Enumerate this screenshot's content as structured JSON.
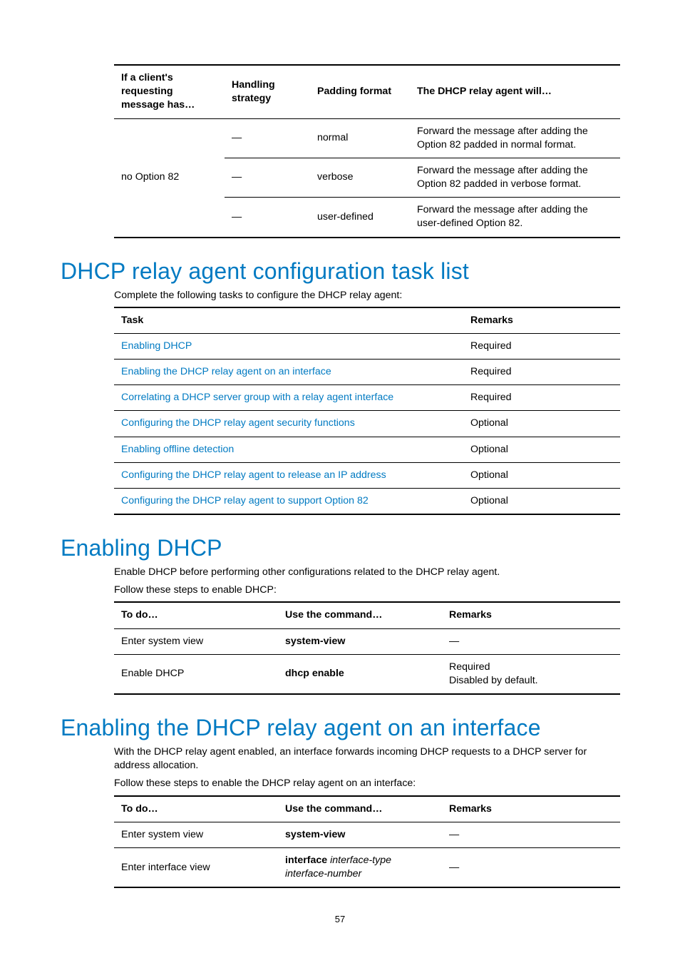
{
  "t1": {
    "h1": "If a client's requesting message has…",
    "h2": "Handling strategy",
    "h3": "Padding format",
    "h4": "The DHCP relay agent will…",
    "rspan": "no Option 82",
    "r1": {
      "strategy": "—",
      "padding": "normal",
      "action": "Forward the message after adding the Option 82 padded in normal format."
    },
    "r2": {
      "strategy": "—",
      "padding": "verbose",
      "action": "Forward the message after adding the Option 82 padded in verbose format."
    },
    "r3": {
      "strategy": "—",
      "padding": "user-defined",
      "action": "Forward the message after adding the user-defined Option 82."
    }
  },
  "sec1": {
    "title": "DHCP relay agent configuration task list",
    "intro": "Complete the following tasks to configure the DHCP relay agent:"
  },
  "t2": {
    "h1": "Task",
    "h2": "Remarks",
    "rows": [
      {
        "task": "Enabling DHCP",
        "rem": "Required"
      },
      {
        "task": "Enabling the DHCP relay agent on an interface",
        "rem": "Required"
      },
      {
        "task": "Correlating a DHCP server group with a relay agent interface",
        "rem": "Required"
      },
      {
        "task": "Configuring the DHCP relay agent security functions",
        "rem": "Optional"
      },
      {
        "task": "Enabling offline detection",
        "rem": "Optional"
      },
      {
        "task": "Configuring the DHCP relay agent to release an IP address",
        "rem": "Optional"
      },
      {
        "task": "Configuring the DHCP relay agent to support Option 82",
        "rem": "Optional"
      }
    ]
  },
  "sec2": {
    "title": "Enabling DHCP",
    "p1": "Enable DHCP before performing other configurations related to the DHCP relay agent.",
    "p2": "Follow these steps to enable DHCP:"
  },
  "t3": {
    "h1": "To do…",
    "h2": "Use the command…",
    "h3": "Remarks",
    "r1": {
      "todo": "Enter system view",
      "cmd": "system-view",
      "rem": "—"
    },
    "r2": {
      "todo": "Enable DHCP",
      "cmd": "dhcp enable",
      "rem1": "Required",
      "rem2": "Disabled by default."
    }
  },
  "sec3": {
    "title": "Enabling the DHCP relay agent on an interface",
    "p1": "With the DHCP relay agent enabled, an interface forwards incoming DHCP requests to a DHCP server for address allocation.",
    "p2": "Follow these steps to enable the DHCP relay agent on an interface:"
  },
  "t4": {
    "h1": "To do…",
    "h2": "Use the command…",
    "h3": "Remarks",
    "r1": {
      "todo": "Enter system view",
      "cmd": "system-view",
      "rem": "—"
    },
    "r2": {
      "todo": "Enter interface view",
      "cmd_b": "interface",
      "cmd_i1": "interface-type",
      "cmd_i2": "interface-number",
      "rem": "—"
    }
  },
  "pageno": "57"
}
